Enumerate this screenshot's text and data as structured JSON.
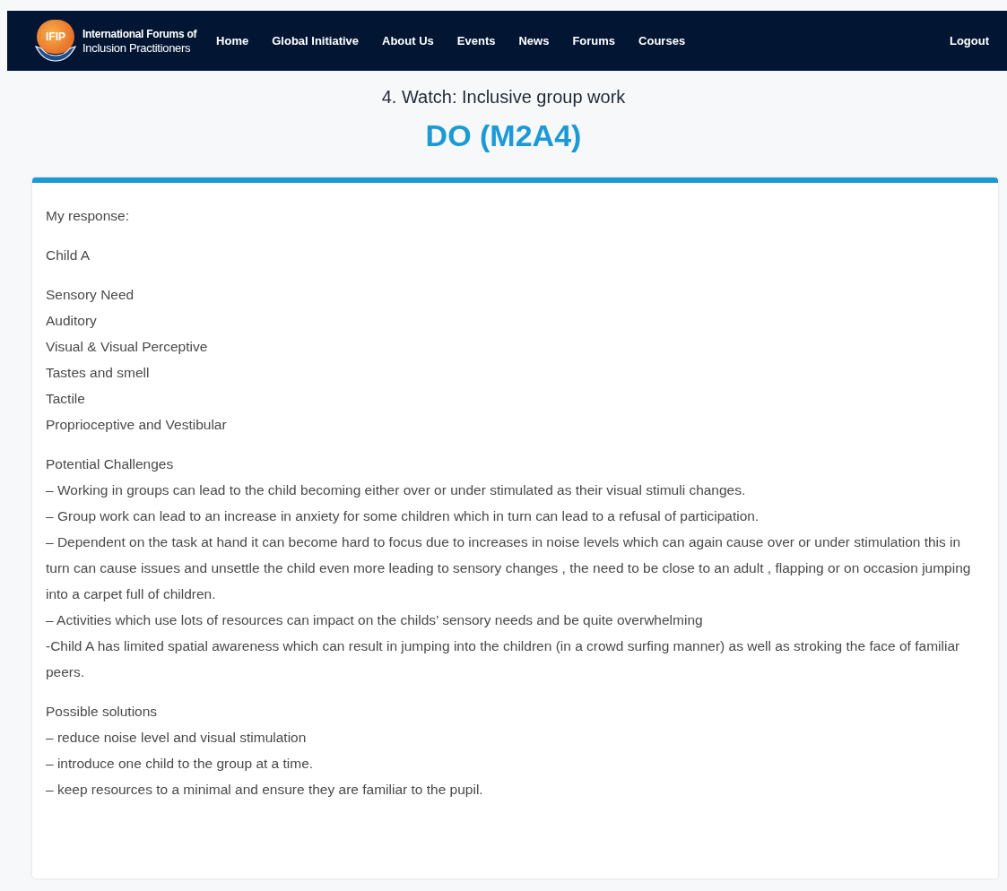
{
  "nav": {
    "logo_mark": "IFIP",
    "logo_line_1": "International Forums of",
    "logo_line_2": "Inclusion Practitioners",
    "items": [
      "Home",
      "Global Initiative",
      "About Us",
      "Events",
      "News",
      "Forums",
      "Courses"
    ],
    "logout": "Logout"
  },
  "page": {
    "subtitle": "4. Watch: Inclusive group work",
    "title": "DO (M2A4)"
  },
  "response": {
    "blocks": [
      [
        "My response:"
      ],
      [
        "Child A"
      ],
      [
        "Sensory Need",
        "Auditory",
        "Visual & Visual Perceptive",
        "Tastes and smell",
        "Tactile",
        "Proprioceptive and Vestibular"
      ],
      [
        "Potential Challenges",
        "– Working in groups can lead to the child becoming either over or under stimulated as their visual stimuli changes.",
        "– Group work can lead to an increase in anxiety for some children which in turn can lead to a refusal of participation.",
        "– Dependent on the task at hand it can become hard to focus due to increases in noise levels which can again cause over or under stimulation this in turn can cause issues and unsettle the child even more leading to sensory changes , the need to be close to an adult , flapping or on occasion jumping into a carpet full of children.",
        "– Activities which use lots of resources can impact on the childs’ sensory needs and be quite overwhelming",
        "-Child A has limited spatial awareness which can result in jumping into the children (in a crowd surfing manner) as well as stroking the face of familiar peers."
      ],
      [
        "Possible solutions",
        "– reduce noise level and visual stimulation",
        "– introduce one child to the group at a time.",
        "– keep resources to a minimal and ensure they are familiar to the pupil."
      ]
    ]
  }
}
